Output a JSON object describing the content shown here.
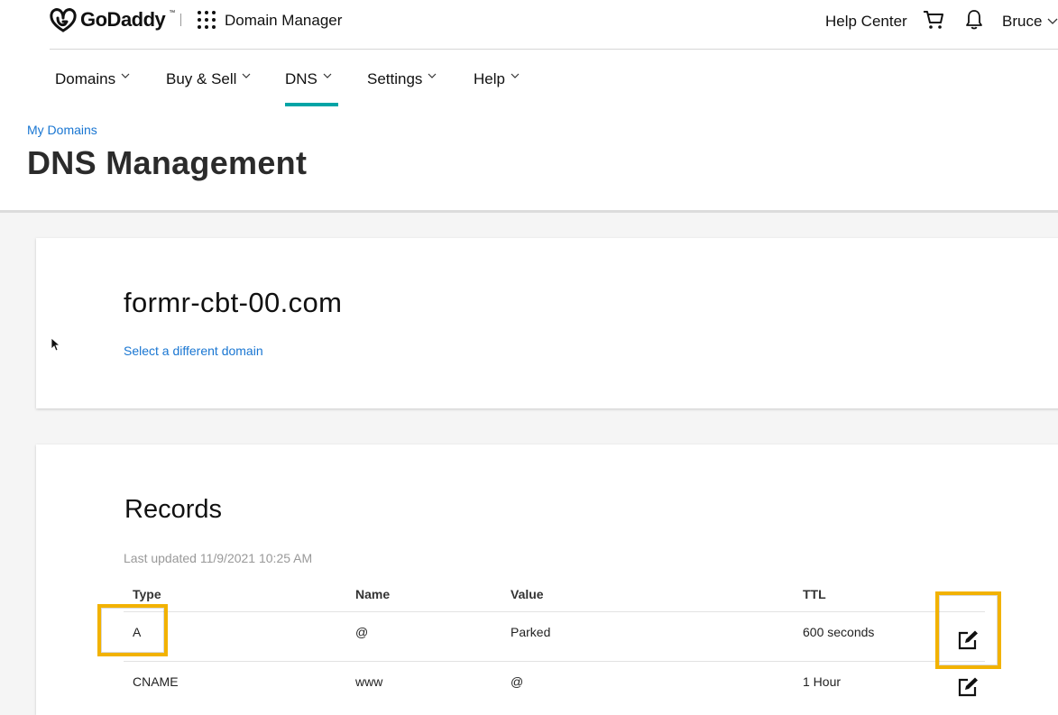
{
  "header": {
    "brand": "GoDaddy",
    "brand_tm": "™",
    "product": "Domain Manager",
    "help_center": "Help Center",
    "user_name": "Bruce"
  },
  "nav": {
    "items": [
      {
        "label": "Domains"
      },
      {
        "label": "Buy & Sell"
      },
      {
        "label": "DNS",
        "active": true
      },
      {
        "label": "Settings"
      },
      {
        "label": "Help"
      }
    ]
  },
  "breadcrumb": "My Domains",
  "page_title": "DNS Management",
  "domain_card": {
    "domain": "formr-cbt-00.com",
    "switch_link": "Select a different domain"
  },
  "records": {
    "title": "Records",
    "last_updated": "Last updated 11/9/2021 10:25 AM",
    "columns": [
      "Type",
      "Name",
      "Value",
      "TTL"
    ],
    "rows": [
      {
        "type": "A",
        "name": "@",
        "value": "Parked",
        "ttl": "600 seconds"
      },
      {
        "type": "CNAME",
        "name": "www",
        "value": "@",
        "ttl": "1 Hour"
      }
    ]
  },
  "colors": {
    "accent": "#00a4a6",
    "link": "#1976d2",
    "highlight": "#f2b200"
  },
  "icons": [
    "godaddy-logo-icon",
    "apps-grid-icon",
    "cart-icon",
    "bell-icon",
    "chevron-down-icon",
    "edit-icon",
    "mouse-cursor-icon"
  ]
}
